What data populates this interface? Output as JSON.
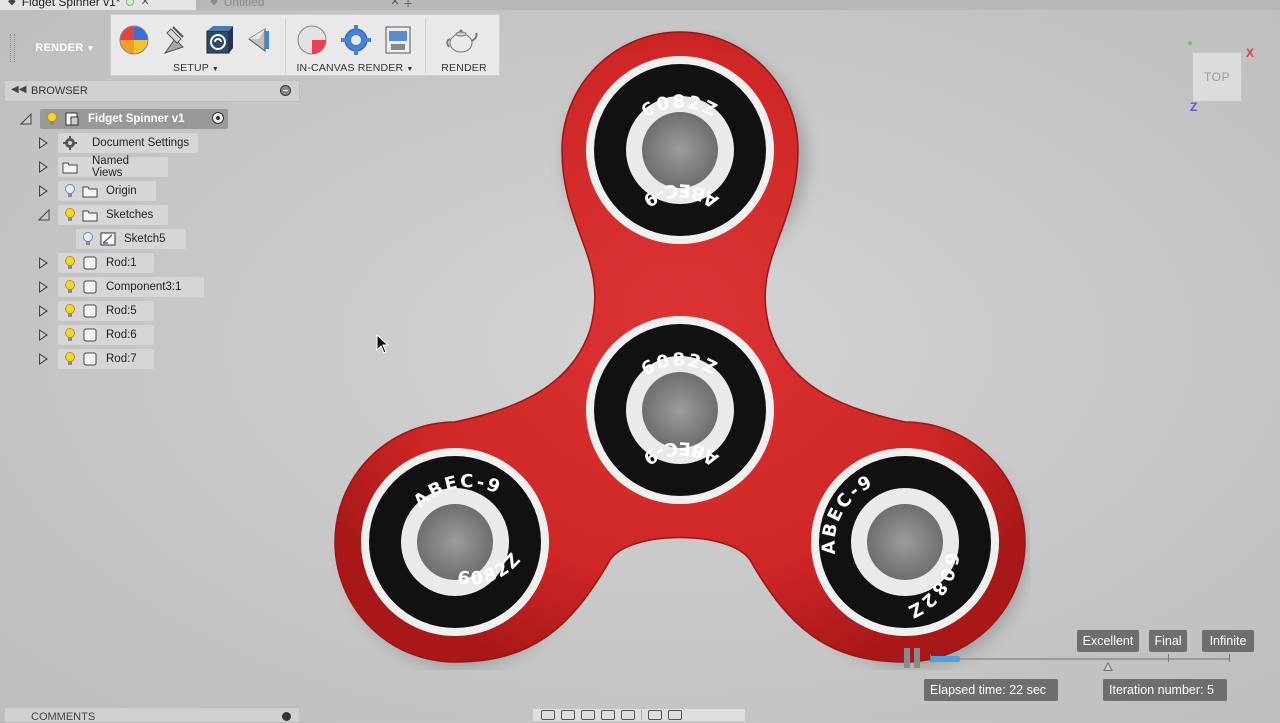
{
  "tabs": [
    {
      "label": "Fidget Spinner v1*",
      "active": true
    },
    {
      "label": "Untitled",
      "active": false
    }
  ],
  "toolbar": {
    "workspace_label": "RENDER",
    "groups": {
      "setup": "SETUP",
      "in_canvas": "IN-CANVAS RENDER",
      "render": "RENDER"
    }
  },
  "browser": {
    "title": "BROWSER",
    "root": "Fidget Spinner v1",
    "items": [
      {
        "label": "Document Settings",
        "icon": "gear-icon"
      },
      {
        "label": "Named Views",
        "icon": "folder-icon"
      },
      {
        "label": "Origin",
        "icon": "folder-icon"
      },
      {
        "label": "Sketches",
        "icon": "folder-icon"
      },
      {
        "label": "Sketch5",
        "icon": "sketch-icon"
      },
      {
        "label": "Rod:1",
        "icon": "component-icon"
      },
      {
        "label": "Component3:1",
        "icon": "component-icon"
      },
      {
        "label": "Rod:5",
        "icon": "component-icon"
      },
      {
        "label": "Rod:6",
        "icon": "component-icon"
      },
      {
        "label": "Rod:7",
        "icon": "component-icon"
      }
    ]
  },
  "viewcube": {
    "face": "TOP",
    "x": "X",
    "z": "Z"
  },
  "model": {
    "bearing_top": "6082Z",
    "bearing_bottom": "ABEC-9",
    "lobe_label_a": "ABEC-9",
    "lobe_label_b": "6082Z"
  },
  "render": {
    "quality_buttons": [
      "Excellent",
      "Final",
      "Infinite"
    ],
    "elapsed": "Elapsed time: 22 sec",
    "iteration": "Iteration number: 5",
    "progress": 0.1
  },
  "comments": {
    "title": "COMMENTS"
  },
  "colors": {
    "spinner_red": "#d42a2a",
    "toolbar_dark": "#5b5b5b",
    "progress_blue": "#4aa3df"
  }
}
